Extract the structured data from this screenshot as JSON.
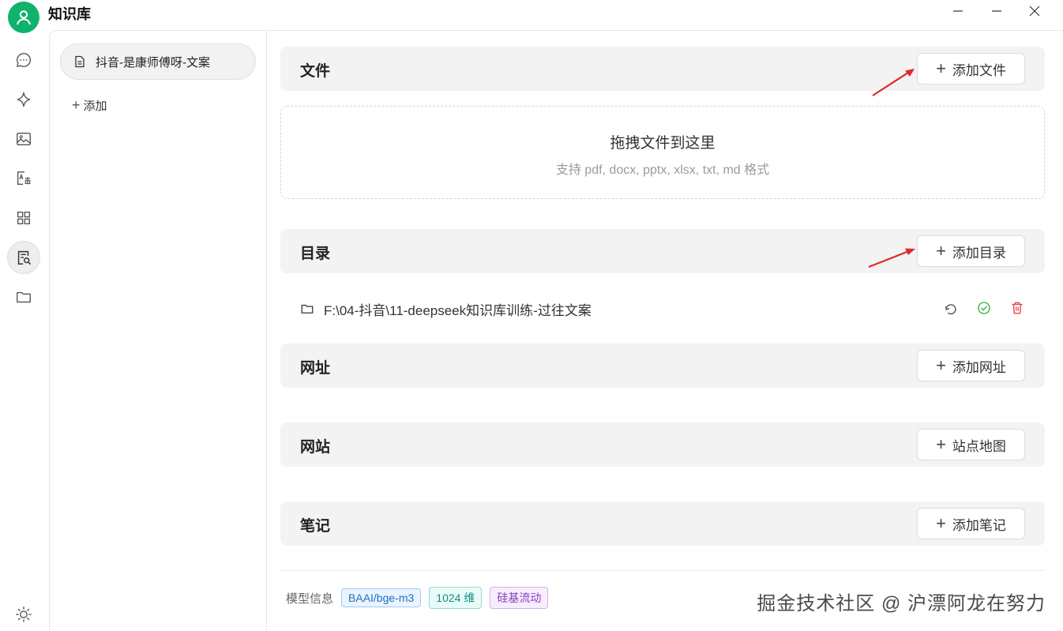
{
  "app": {
    "title": "知识库"
  },
  "rail": {
    "icons": [
      "chat-icon",
      "sparkle-icon",
      "image-icon",
      "translate-icon",
      "apps-icon",
      "knowledge-icon",
      "folder-icon",
      "theme-icon"
    ],
    "active": "knowledge-icon"
  },
  "knowledge_bases": {
    "items": [
      {
        "label": "抖音-是康师傅呀-文案"
      }
    ],
    "add_label": "添加"
  },
  "sections": {
    "files": {
      "title": "文件",
      "button": "添加文件"
    },
    "dropzone": {
      "title": "拖拽文件到这里",
      "subtitle": "支持 pdf, docx, pptx, xlsx, txt, md 格式"
    },
    "directory": {
      "title": "目录",
      "button": "添加目录",
      "path": "F:\\04-抖音\\11-deepseek知识库训练-过往文案"
    },
    "url": {
      "title": "网址",
      "button": "添加网址"
    },
    "website": {
      "title": "网站",
      "button": "站点地图"
    },
    "notes": {
      "title": "笔记",
      "button": "添加笔记"
    }
  },
  "model_info": {
    "label": "模型信息",
    "tags": [
      "BAAI/bge-m3",
      "1024 维",
      "硅基流动"
    ]
  },
  "watermark": "掘金技术社区 @ 沪漂阿龙在努力",
  "colors": {
    "accent": "#10b36b",
    "arrow": "#e0282c",
    "delete": "#e5484d",
    "check": "#3bb54a"
  }
}
